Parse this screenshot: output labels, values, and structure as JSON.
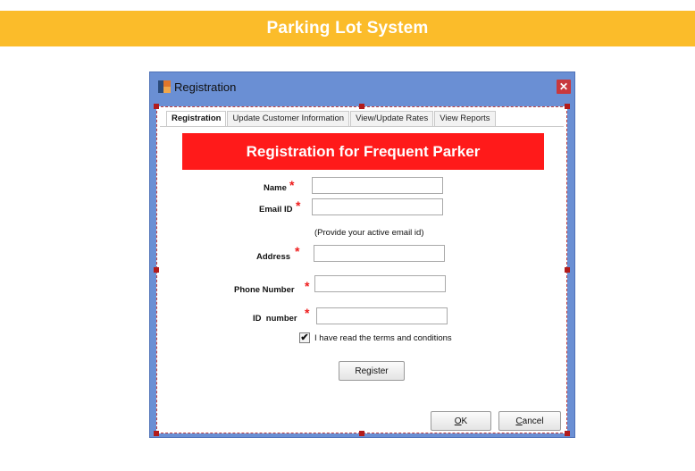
{
  "banner": {
    "title": "Parking Lot System"
  },
  "window": {
    "title": "Registration",
    "close_glyph": "✕",
    "icon": "app-window-icon"
  },
  "tabs": [
    {
      "label": "Registration",
      "active": true
    },
    {
      "label": "Update Customer Information",
      "active": false
    },
    {
      "label": "View/Update Rates",
      "active": false
    },
    {
      "label": "View Reports",
      "active": false
    }
  ],
  "form": {
    "header": "Registration for Frequent Parker",
    "required_marker": "*",
    "fields": {
      "name": {
        "label": "Name",
        "value": ""
      },
      "email": {
        "label": "Email ID",
        "value": "",
        "hint": "(Provide your active email id)"
      },
      "address": {
        "label": "Address",
        "value": ""
      },
      "phone": {
        "label": "Phone Number",
        "value": ""
      },
      "id_number": {
        "label": "ID  number",
        "value": ""
      }
    },
    "terms": {
      "label": "I have read the terms and conditions",
      "checked": true,
      "check_glyph": "✔"
    },
    "register_label": "Register"
  },
  "dialog_buttons": {
    "ok_mnemonic": "O",
    "ok_rest": "K",
    "cancel_mnemonic": "C",
    "cancel_rest": "ancel"
  },
  "colors": {
    "banner": "#fbbc2a",
    "window_frame": "#6a8fd4",
    "header_red": "#ff1a1a",
    "required_red": "#ee1c1c",
    "close_button": "#c8383d"
  }
}
